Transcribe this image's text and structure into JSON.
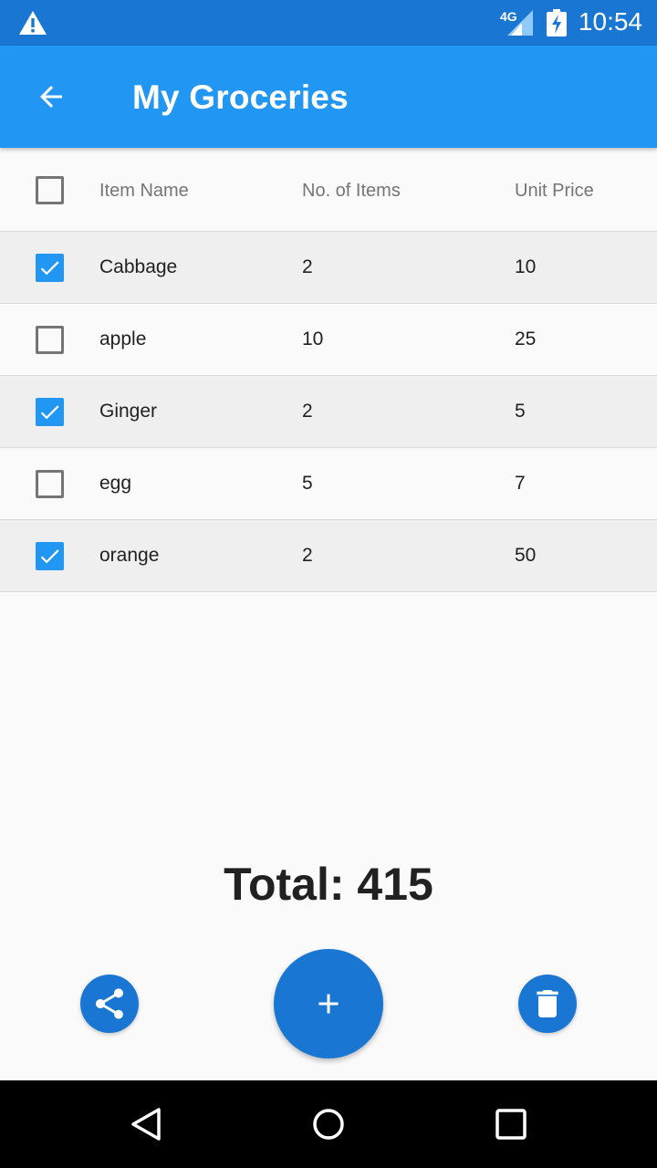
{
  "status_bar": {
    "network": "4G",
    "time": "10:54",
    "icons": [
      "warning-icon",
      "signal-icon",
      "battery-charging-icon"
    ]
  },
  "app_bar": {
    "title": "My Groceries",
    "back_icon": "arrow-back-icon"
  },
  "table": {
    "headers": [
      "Item Name",
      "No. of Items",
      "Unit Price"
    ],
    "select_all_checked": false,
    "rows": [
      {
        "checked": true,
        "name": "Cabbage",
        "qty": "2",
        "price": "10"
      },
      {
        "checked": false,
        "name": "apple",
        "qty": "10",
        "price": "25"
      },
      {
        "checked": true,
        "name": "Ginger",
        "qty": "2",
        "price": "5"
      },
      {
        "checked": false,
        "name": "egg",
        "qty": "5",
        "price": "7"
      },
      {
        "checked": true,
        "name": "orange",
        "qty": "2",
        "price": "50"
      }
    ]
  },
  "total": {
    "text": "Total: 415"
  },
  "actions": {
    "share_icon": "share-icon",
    "add_icon": "plus-icon",
    "delete_icon": "trash-icon"
  },
  "colors": {
    "status_bar": "#1976d2",
    "app_bar": "#2196f3",
    "accent": "#1976d2",
    "checkbox_checked": "#2196f3"
  }
}
